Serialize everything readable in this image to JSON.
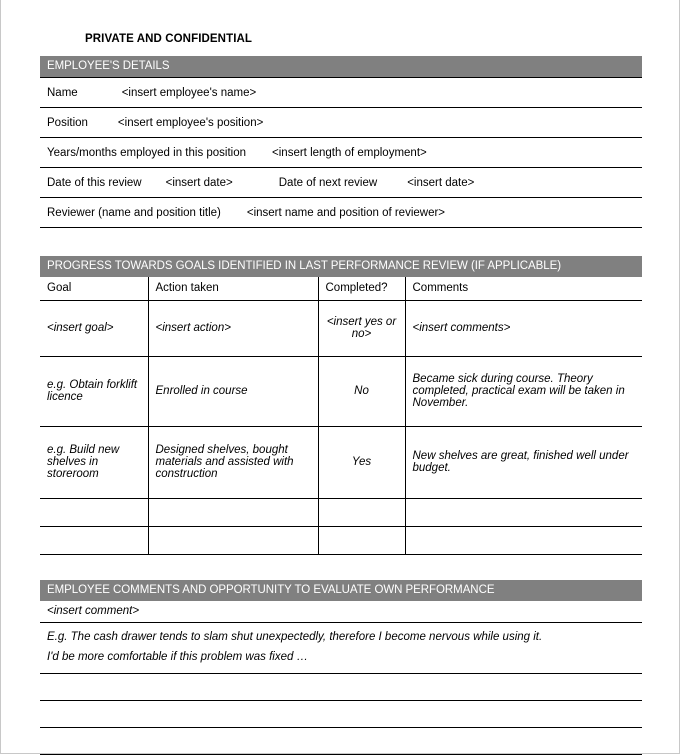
{
  "document": {
    "title": "PRIVATE AND CONFIDENTIAL",
    "banner_color": "#808080",
    "banner_text_color": "#ffffff",
    "page_background": "#ffffff",
    "rule_color": "#000000"
  },
  "employee_details": {
    "banner": "EMPLOYEE'S DETAILS",
    "rows": [
      {
        "label": "Name",
        "value": "<insert employee's name>"
      },
      {
        "label": "Position",
        "value": "<insert employee's position>"
      },
      {
        "label": "Years/months employed in this position",
        "value": "<insert length of employment>"
      },
      {
        "label": "Date of this review",
        "value": "<insert date>",
        "label2": "Date of next review",
        "value2": "<insert date>"
      },
      {
        "label": "Reviewer (name and position title)",
        "value": "<insert name and position of reviewer>"
      }
    ]
  },
  "progress_section": {
    "banner": "PROGRESS TOWARDS GOALS IDENTIFIED IN LAST PERFORMANCE REVIEW (IF APPLICABLE)",
    "columns": [
      "Goal",
      "Action taken",
      "Completed?",
      "Comments"
    ],
    "rows": [
      {
        "goal": "<insert goal>",
        "action": "<insert action>",
        "completed": "<insert yes or no>",
        "comments": "<insert comments>"
      },
      {
        "goal": "e.g. Obtain forklift licence",
        "action": "Enrolled in course",
        "completed": "No",
        "comments": "Became sick during course. Theory completed, practical exam will be taken in November."
      },
      {
        "goal": "e.g. Build new shelves in storeroom",
        "action": "Designed shelves, bought materials and assisted with construction",
        "completed": "Yes",
        "comments": "New shelves are great, finished well under budget."
      },
      {
        "goal": "",
        "action": "",
        "completed": "",
        "comments": ""
      },
      {
        "goal": "",
        "action": "",
        "completed": "",
        "comments": ""
      }
    ]
  },
  "employee_comments": {
    "banner": "EMPLOYEE COMMENTS AND OPPORTUNITY TO EVALUATE OWN PERFORMANCE",
    "insert_placeholder": "<insert comment>",
    "example_line_1": "E.g. The cash drawer tends to slam shut unexpectedly, therefore I become nervous while using it.",
    "example_line_2": "I'd be more comfortable if this problem was fixed …",
    "blank_lines": 3
  }
}
